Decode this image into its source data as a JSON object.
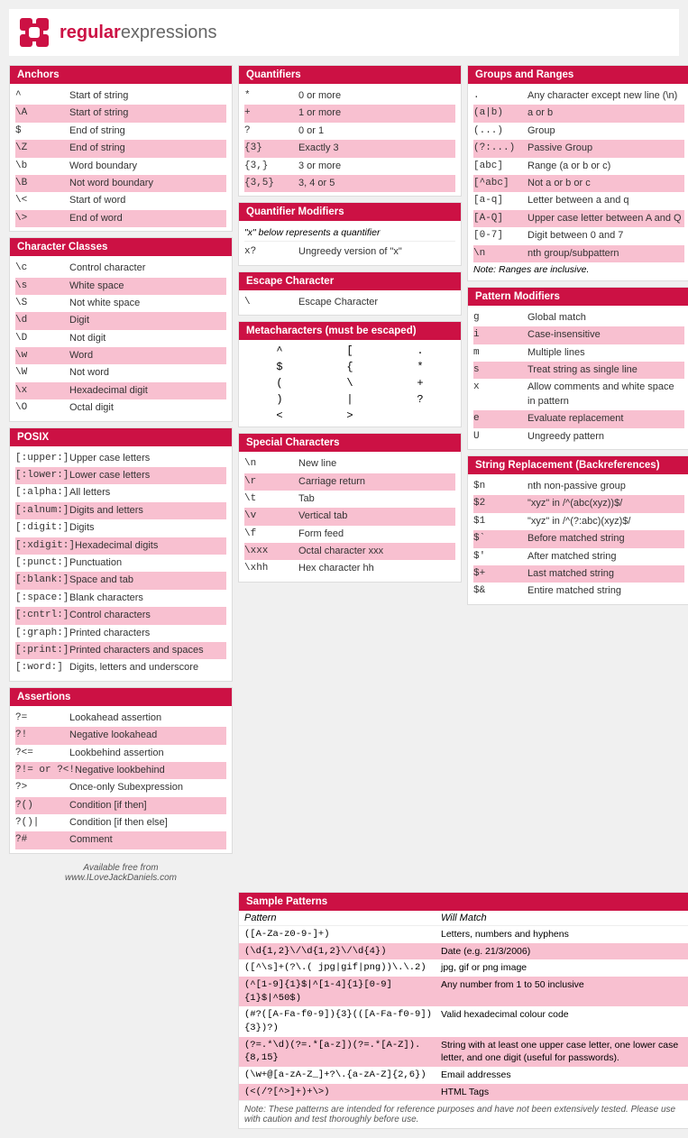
{
  "header": {
    "logo_regular": "regular",
    "logo_expressions": "expressions",
    "site": "regularexpressions"
  },
  "anchors": {
    "title": "Anchors",
    "rows": [
      {
        "code": "^",
        "desc": "Start of string",
        "highlight": false
      },
      {
        "code": "\\A",
        "desc": "Start of string",
        "highlight": true
      },
      {
        "code": "$",
        "desc": "End of string",
        "highlight": false
      },
      {
        "code": "\\Z",
        "desc": "End of string",
        "highlight": true
      },
      {
        "code": "\\b",
        "desc": "Word boundary",
        "highlight": false
      },
      {
        "code": "\\B",
        "desc": "Not word boundary",
        "highlight": true
      },
      {
        "code": "\\<",
        "desc": "Start of word",
        "highlight": false
      },
      {
        "code": "\\>",
        "desc": "End of word",
        "highlight": true
      }
    ]
  },
  "character_classes": {
    "title": "Character Classes",
    "rows": [
      {
        "code": "\\c",
        "desc": "Control character",
        "highlight": false
      },
      {
        "code": "\\s",
        "desc": "White space",
        "highlight": true
      },
      {
        "code": "\\S",
        "desc": "Not white space",
        "highlight": false
      },
      {
        "code": "\\d",
        "desc": "Digit",
        "highlight": true
      },
      {
        "code": "\\D",
        "desc": "Not digit",
        "highlight": false
      },
      {
        "code": "\\w",
        "desc": "Word",
        "highlight": true
      },
      {
        "code": "\\W",
        "desc": "Not word",
        "highlight": false
      },
      {
        "code": "\\x",
        "desc": "Hexadecimal digit",
        "highlight": true
      },
      {
        "code": "\\O",
        "desc": "Octal digit",
        "highlight": false
      }
    ]
  },
  "posix": {
    "title": "POSIX",
    "rows": [
      {
        "code": "[:upper:]",
        "desc": "Upper case letters",
        "highlight": false
      },
      {
        "code": "[:lower:]",
        "desc": "Lower case letters",
        "highlight": true
      },
      {
        "code": "[:alpha:]",
        "desc": "All letters",
        "highlight": false
      },
      {
        "code": "[:alnum:]",
        "desc": "Digits and letters",
        "highlight": true
      },
      {
        "code": "[:digit:]",
        "desc": "Digits",
        "highlight": false
      },
      {
        "code": "[:xdigit:]",
        "desc": "Hexadecimal digits",
        "highlight": true
      },
      {
        "code": "[:punct:]",
        "desc": "Punctuation",
        "highlight": false
      },
      {
        "code": "[:blank:]",
        "desc": "Space and tab",
        "highlight": true
      },
      {
        "code": "[:space:]",
        "desc": "Blank characters",
        "highlight": false
      },
      {
        "code": "[:cntrl:]",
        "desc": "Control characters",
        "highlight": true
      },
      {
        "code": "[:graph:]",
        "desc": "Printed characters",
        "highlight": false
      },
      {
        "code": "[:print:]",
        "desc": "Printed characters and spaces",
        "highlight": true
      },
      {
        "code": "[:word:]",
        "desc": "Digits, letters and underscore",
        "highlight": false
      }
    ]
  },
  "assertions": {
    "title": "Assertions",
    "rows": [
      {
        "code": "?=",
        "desc": "Lookahead assertion",
        "highlight": false
      },
      {
        "code": "?!",
        "desc": "Negative lookahead",
        "highlight": true
      },
      {
        "code": "?<=",
        "desc": "Lookbehind assertion",
        "highlight": false
      },
      {
        "code": "?!= or ?<!",
        "desc": "Negative lookbehind",
        "highlight": true
      },
      {
        "code": "?>",
        "desc": "Once-only Subexpression",
        "highlight": false
      },
      {
        "code": "?()",
        "desc": "Condition [if then]",
        "highlight": true
      },
      {
        "code": "?()|",
        "desc": "Condition [if then else]",
        "highlight": false
      },
      {
        "code": "?#",
        "desc": "Comment",
        "highlight": true
      }
    ]
  },
  "footer": {
    "line1": "Available free from",
    "line2": "www.ILoveJackDaniels.com"
  },
  "quantifiers": {
    "title": "Quantifiers",
    "rows": [
      {
        "code": "*",
        "desc": "0 or more",
        "highlight": false
      },
      {
        "code": "+",
        "desc": "1 or more",
        "highlight": true
      },
      {
        "code": "?",
        "desc": "0 or 1",
        "highlight": false
      },
      {
        "code": "{3}",
        "desc": "Exactly 3",
        "highlight": true
      },
      {
        "code": "{3,}",
        "desc": "3 or more",
        "highlight": false
      },
      {
        "code": "{3,5}",
        "desc": "3, 4 or 5",
        "highlight": true
      }
    ]
  },
  "quantifier_modifiers": {
    "title": "Quantifier Modifiers",
    "note": "\"x\" below represents a quantifier",
    "row": {
      "code": "x?",
      "desc": "Ungreedy version of \"x\""
    }
  },
  "escape_character": {
    "title": "Escape Character",
    "code": "\\",
    "desc": "Escape Character"
  },
  "metacharacters": {
    "title": "Metacharacters (must be escaped)",
    "chars": [
      "^",
      "[",
      ".",
      "$",
      "{",
      "*",
      "(",
      "\\",
      "+",
      ")",
      "|",
      "?",
      "<",
      ">"
    ]
  },
  "special_characters": {
    "title": "Special Characters",
    "rows": [
      {
        "code": "\\n",
        "desc": "New line",
        "highlight": false
      },
      {
        "code": "\\r",
        "desc": "Carriage return",
        "highlight": true
      },
      {
        "code": "\\t",
        "desc": "Tab",
        "highlight": false
      },
      {
        "code": "\\v",
        "desc": "Vertical tab",
        "highlight": true
      },
      {
        "code": "\\f",
        "desc": "Form feed",
        "highlight": false
      },
      {
        "code": "\\xxx",
        "desc": "Octal character xxx",
        "highlight": true
      },
      {
        "code": "\\xhh",
        "desc": "Hex character hh",
        "highlight": false
      }
    ]
  },
  "groups_ranges": {
    "title": "Groups and Ranges",
    "rows": [
      {
        "code": ".",
        "desc": "Any character except new line (\\n)",
        "highlight": false
      },
      {
        "code": "(a|b)",
        "desc": "a or b",
        "highlight": true
      },
      {
        "code": "(...)",
        "desc": "Group",
        "highlight": false
      },
      {
        "code": "(?:...)",
        "desc": "Passive Group",
        "highlight": true
      },
      {
        "code": "[abc]",
        "desc": "Range (a or b or c)",
        "highlight": false
      },
      {
        "code": "[^abc]",
        "desc": "Not a or b or c",
        "highlight": true
      },
      {
        "code": "[a-q]",
        "desc": "Letter between a and q",
        "highlight": false
      },
      {
        "code": "[A-Q]",
        "desc": "Upper case letter between A and Q",
        "highlight": true
      },
      {
        "code": "[0-7]",
        "desc": "Digit between 0 and 7",
        "highlight": false
      },
      {
        "code": "\\n",
        "desc": "nth group/subpattern",
        "highlight": true
      },
      {
        "note": "Note: Ranges are inclusive."
      }
    ]
  },
  "pattern_modifiers": {
    "title": "Pattern Modifiers",
    "rows": [
      {
        "code": "g",
        "desc": "Global match",
        "highlight": false
      },
      {
        "code": "i",
        "desc": "Case-insensitive",
        "highlight": true
      },
      {
        "code": "m",
        "desc": "Multiple lines",
        "highlight": false
      },
      {
        "code": "s",
        "desc": "Treat string as single line",
        "highlight": true
      },
      {
        "code": "x",
        "desc": "Allow comments and white space in pattern",
        "highlight": false
      },
      {
        "code": "e",
        "desc": "Evaluate replacement",
        "highlight": true
      },
      {
        "code": "U",
        "desc": "Ungreedy pattern",
        "highlight": false
      }
    ]
  },
  "string_replacement": {
    "title": "String Replacement (Backreferences)",
    "rows": [
      {
        "code": "$n",
        "desc": "nth non-passive group",
        "highlight": false
      },
      {
        "code": "$2",
        "desc": "\"xyz\" in /^(abc(xyz))$/",
        "highlight": true
      },
      {
        "code": "$1",
        "desc": "\"xyz\" in /^(?:abc)(xyz)$/",
        "highlight": false
      },
      {
        "code": "$`",
        "desc": "Before matched string",
        "highlight": true
      },
      {
        "code": "$'",
        "desc": "After matched string",
        "highlight": false
      },
      {
        "code": "$+",
        "desc": "Last matched string",
        "highlight": true
      },
      {
        "code": "$&",
        "desc": "Entire matched string",
        "highlight": false
      }
    ]
  },
  "sample_patterns": {
    "title": "Sample Patterns",
    "header_pattern": "Pattern",
    "header_match": "Will Match",
    "rows": [
      {
        "pattern": "([A-Za-z0-9-]+)",
        "desc": "Letters, numbers and hyphens",
        "highlight": false
      },
      {
        "pattern": "(\\d{1,2}\\/\\d{1,2}\\/\\d{4})",
        "desc": "Date (e.g. 21/3/2006)",
        "highlight": true
      },
      {
        "pattern": "([^\\s]+(?\\.( jpg|gif|png))\\.\\.2)",
        "desc": "jpg, gif or png image",
        "highlight": false
      },
      {
        "pattern": "(^[1-9]{1}$|^[1-4]{1}[0-9]{1}$|^50$)",
        "desc": "Any number from 1 to 50 inclusive",
        "highlight": true
      },
      {
        "pattern": "(#?([A-Fa-f0-9]){3}(([A-Fa-f0-9]){3})?)",
        "desc": "Valid hexadecimal colour code",
        "highlight": false
      },
      {
        "pattern": "(?=.*\\d)(?=.*[a-z])(?=.*[A-Z]).{8,15}",
        "desc": "String with at least one upper case letter, one lower case letter, and one digit (useful for passwords).",
        "highlight": true
      },
      {
        "pattern": "(\\w+@[a-zA-Z_]+?\\.{a-zA-Z]{2,6})",
        "desc": "Email addresses",
        "highlight": false
      },
      {
        "pattern": "(<(/?[^>]+)+\\>)",
        "desc": "HTML Tags",
        "highlight": true
      }
    ],
    "disclaimer": "Note: These patterns are intended for reference purposes and have not been extensively tested. Please use with caution and test thoroughly before use."
  }
}
